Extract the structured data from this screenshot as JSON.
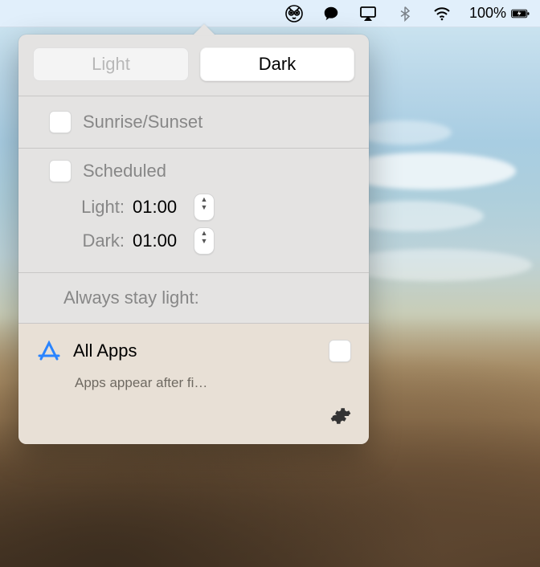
{
  "menubar": {
    "battery_pct": "100%",
    "icons": {
      "owl": "owl-icon",
      "chat": "chat-bubble-icon",
      "airplay": "airplay-icon",
      "bluetooth": "bluetooth-icon",
      "wifi": "wifi-icon",
      "battery": "battery-charging-icon"
    }
  },
  "popover": {
    "segments": {
      "light": "Light",
      "dark": "Dark",
      "active": "dark"
    },
    "sunrise": {
      "label": "Sunrise/Sunset",
      "checked": false
    },
    "scheduled": {
      "label": "Scheduled",
      "checked": false,
      "light_label": "Light:",
      "light_time": "01:00",
      "dark_label": "Dark:",
      "dark_time": "01:00"
    },
    "stay_light_label": "Always stay light:",
    "apps": {
      "title": "All Apps",
      "checked": false,
      "subtitle": "Apps appear after fi…"
    }
  }
}
